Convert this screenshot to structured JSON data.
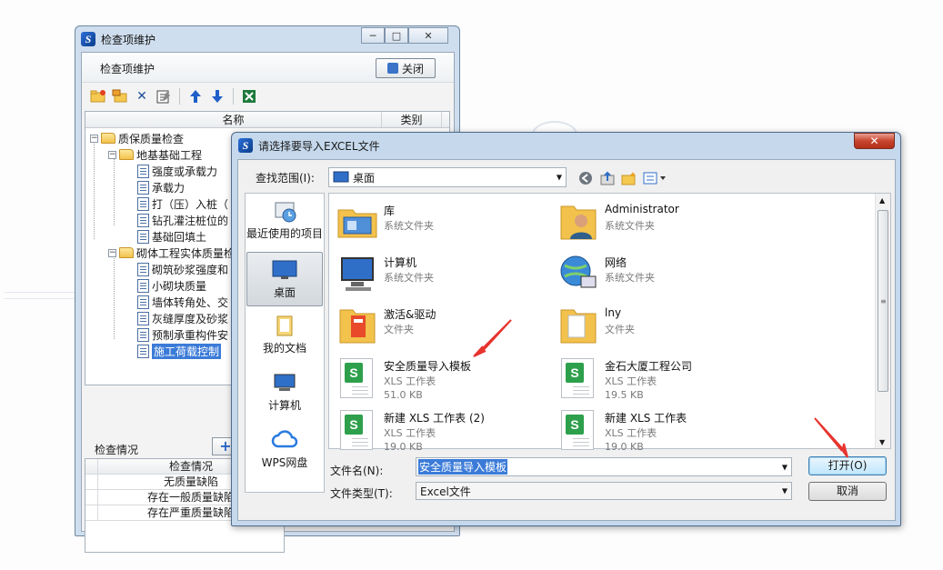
{
  "bg_window": {
    "title": "检查项维护",
    "header_label": "检查项维护",
    "close_label": "关闭",
    "tree_col_name": "名称",
    "tree_col_type": "类别",
    "tree": {
      "root": "质保质量检查",
      "group1": "地基基础工程",
      "g1_items": [
        "强度或承载力",
        "承载力",
        "打（压）入桩（",
        "钻孔灌注桩位的",
        "基础回填土"
      ],
      "group2": "砌体工程实体质量检",
      "g2_items": [
        "砌筑砂浆强度和",
        "小砌块质量",
        "墙体转角处、交",
        "灰缝厚度及砂浆",
        "预制承重构件安",
        "施工荷载控制"
      ]
    },
    "section2_title": "检查情况",
    "grid_header": "检查情况",
    "grid_rows": [
      "无质量缺陷",
      "存在一般质量缺陷",
      "存在严重质量缺陷"
    ]
  },
  "dialog": {
    "title": "请选择要导入EXCEL文件",
    "look_in_label": "查找范围(I):",
    "look_in_value": "桌面",
    "places": [
      "最近使用的项目",
      "桌面",
      "我的文档",
      "计算机",
      "WPS网盘"
    ],
    "files": [
      {
        "name": "库",
        "l1": "系统文件夹",
        "l2": ""
      },
      {
        "name": "Administrator",
        "l1": "系统文件夹",
        "l2": ""
      },
      {
        "name": "计算机",
        "l1": "系统文件夹",
        "l2": ""
      },
      {
        "name": "网络",
        "l1": "系统文件夹",
        "l2": ""
      },
      {
        "name": "激活&驱动",
        "l1": "文件夹",
        "l2": ""
      },
      {
        "name": "lny",
        "l1": "文件夹",
        "l2": ""
      },
      {
        "name": "安全质量导入模板",
        "l1": "XLS 工作表",
        "l2": "51.0 KB"
      },
      {
        "name": "金石大厦工程公司",
        "l1": "XLS 工作表",
        "l2": "19.5 KB"
      },
      {
        "name": "新建 XLS 工作表 (2)",
        "l1": "XLS 工作表",
        "l2": "19.0 KB"
      },
      {
        "name": "新建 XLS 工作表",
        "l1": "XLS 工作表",
        "l2": "19.0 KB"
      }
    ],
    "filename_label": "文件名(N):",
    "filename_value": "安全质量导入模板",
    "filetype_label": "文件类型(T):",
    "filetype_value": "Excel文件",
    "open_label": "打开(O)",
    "cancel_label": "取消"
  },
  "colors": {
    "accent": "#3b7bd8",
    "annotation_arrow": "#e8332e"
  }
}
